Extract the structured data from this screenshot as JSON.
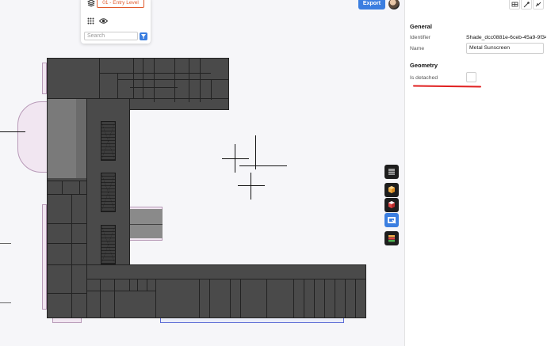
{
  "level_panel": {
    "level_label": "01 - Entry Level",
    "search_placeholder": "Search"
  },
  "header": {
    "export_label": "Export"
  },
  "panel": {
    "general_title": "General",
    "identifier_label": "Identifier",
    "identifier_value": "Shade_dcc0881e-6ceb-45a9-9f34...",
    "name_label": "Name",
    "name_value": "Metal Sunscreen",
    "geometry_title": "Geometry",
    "detached_label": "Is detached",
    "detached_checked": false
  },
  "toolbar": {
    "icons": [
      "layers-icon",
      "cube-orange-icon",
      "cube-red-icon",
      "cube-blue-icon",
      "stack-icon"
    ]
  },
  "colors": {
    "accent": "#3b7ee0",
    "underline": "#e02020",
    "level_label": "#e05a2b"
  }
}
